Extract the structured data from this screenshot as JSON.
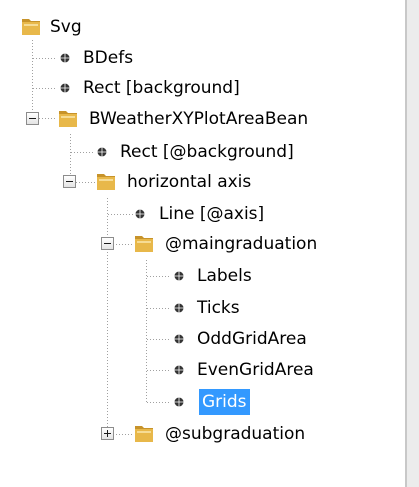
{
  "tree": {
    "nodes": [
      {
        "label": "Svg",
        "icon": "folder-icon",
        "expanded": true
      },
      {
        "label": "BDefs",
        "icon": "node-dot-icon"
      },
      {
        "label": "Rect [background]",
        "icon": "node-dot-icon"
      },
      {
        "label": "BWeatherXYPlotAreaBean",
        "icon": "folder-icon",
        "expanded": true
      },
      {
        "label": "Rect [@background]",
        "icon": "node-dot-icon"
      },
      {
        "label": "horizontal axis",
        "icon": "folder-icon",
        "expanded": true
      },
      {
        "label": "Line [@axis]",
        "icon": "node-dot-icon"
      },
      {
        "label": "@maingraduation",
        "icon": "folder-icon",
        "expanded": true
      },
      {
        "label": "Labels",
        "icon": "node-dot-icon"
      },
      {
        "label": "Ticks",
        "icon": "node-dot-icon"
      },
      {
        "label": "OddGridArea",
        "icon": "node-dot-icon"
      },
      {
        "label": "EvenGridArea",
        "icon": "node-dot-icon"
      },
      {
        "label": "Grids",
        "icon": "node-dot-icon",
        "selected": true
      },
      {
        "label": "@subgraduation",
        "icon": "folder-icon",
        "expanded": false
      }
    ]
  },
  "colors": {
    "selection": "#3399ff",
    "folder": "#e8b84a",
    "folder_dark": "#c7932a",
    "tree_lines": "#a0a0a0",
    "leaf_dot": "#333333"
  }
}
